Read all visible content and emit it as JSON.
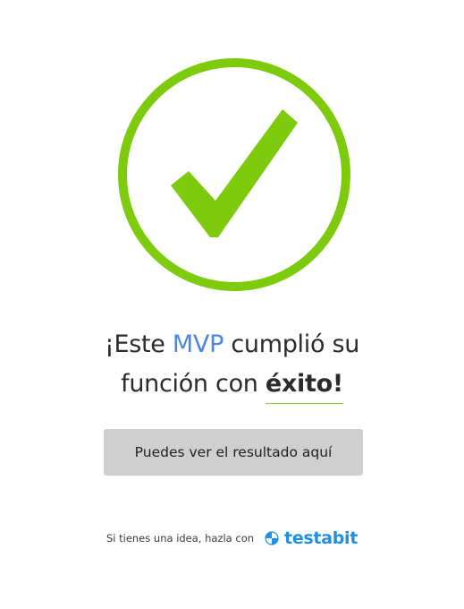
{
  "colors": {
    "success_green": "#7ecb0e",
    "accent_blue": "#4a86e8",
    "button_bg": "#cfcfcf",
    "brand_blue": "#1f8fe6"
  },
  "hero": {
    "icon": "checkmark-circle-icon"
  },
  "headline": {
    "prefix": "¡Este ",
    "highlight": "MVP",
    "middle": " cumplió su",
    "line2_prefix": "función con ",
    "emphasis": "éxito!"
  },
  "button": {
    "label": "Puedes ver el resultado aquí"
  },
  "footer": {
    "text": "Si tienes una idea, hazla con",
    "brand_icon": "testabit-logo-icon",
    "brand_name": "testabit"
  }
}
